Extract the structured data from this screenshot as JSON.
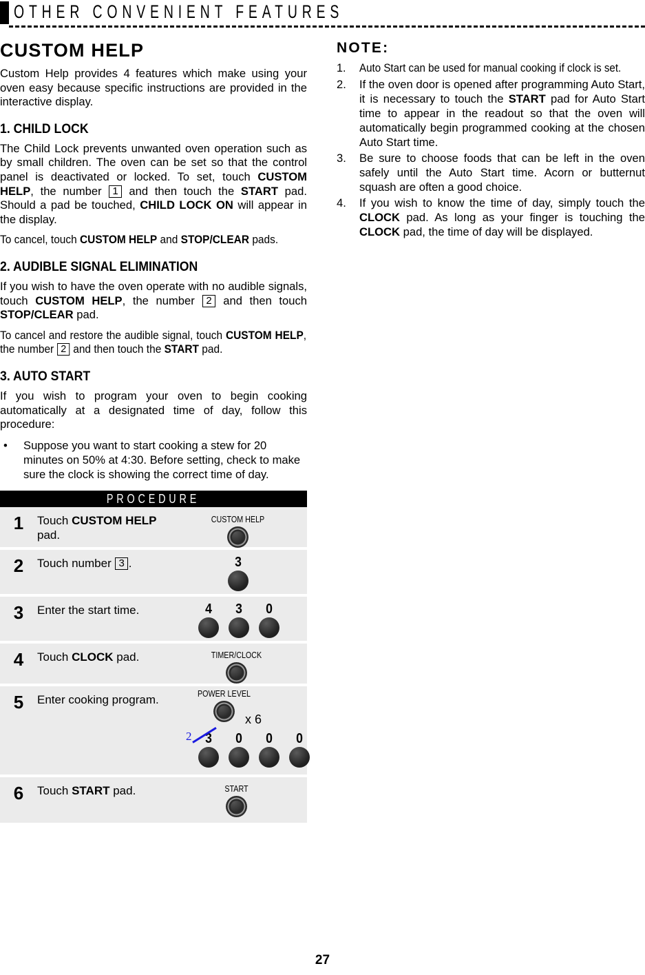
{
  "header": {
    "title": "OTHER CONVENIENT FEATURES"
  },
  "left_column": {
    "section_title": "CUSTOM HELP",
    "intro": "Custom Help provides 4 features which make using your oven easy because specific instructions are provided in the interactive display.",
    "child_lock": {
      "heading": "1.  CHILD LOCK",
      "p1_a": "The Child Lock prevents unwanted oven operation such as by small children. The oven can be set so that the control panel is deactivated or locked. To set, touch ",
      "p1_b": "CUSTOM HELP",
      "p1_c": ", the number ",
      "p1_key": "1",
      "p1_d": " and then touch the ",
      "p1_e": "START",
      "p1_f": " pad. Should a pad be touched, ",
      "p1_g": "CHILD LOCK ON",
      "p1_h": " will appear in the display.",
      "p2_a": "To cancel, touch ",
      "p2_b": "CUSTOM HELP",
      "p2_c": " and ",
      "p2_d": "STOP/CLEAR",
      "p2_e": " pads."
    },
    "audible": {
      "heading": "2.  AUDIBLE SIGNAL ELIMINATION",
      "p1_a": "If you wish to have the oven operate with no audible signals, touch ",
      "p1_b": "CUSTOM HELP",
      "p1_c": ", the number ",
      "p1_key": "2",
      "p1_d": " and then touch ",
      "p1_e": "STOP/CLEAR",
      "p1_f": " pad.",
      "p2_a": "To cancel and restore the audible signal, touch ",
      "p2_b": "CUSTOM HELP",
      "p2_c": ", the number ",
      "p2_key": "2",
      "p2_d": " and then touch the ",
      "p2_e": "START",
      "p2_f": " pad."
    },
    "auto_start": {
      "heading": "3.  AUTO START",
      "p1": "If you wish to program your oven to begin cooking automatically at a designated time of day, follow this procedure:",
      "bullet_dot": "•",
      "bullet1": "Suppose you want to start cooking a stew for 20 minutes on 50% at 4:30. Before setting, check to make sure the clock is showing the correct time of day."
    }
  },
  "procedure": {
    "heading": "PROCEDURE",
    "steps": [
      {
        "num": "1",
        "text_a": "Touch ",
        "text_b": "CUSTOM HELP",
        "text_c": " pad.",
        "pads": [
          {
            "caption": "CUSTOM HELP",
            "style": "ringed",
            "digit": ""
          }
        ]
      },
      {
        "num": "2",
        "text_a": "Touch number ",
        "key": "3",
        "text_c": ".",
        "pads": [
          {
            "caption": "",
            "style": "plain",
            "digit": "3"
          }
        ]
      },
      {
        "num": "3",
        "text_a": "Enter the start time.",
        "text_b": "",
        "text_c": "",
        "pads": [
          {
            "caption": "",
            "style": "plain",
            "digit": "4"
          },
          {
            "caption": "",
            "style": "plain",
            "digit": "3"
          },
          {
            "caption": "",
            "style": "plain",
            "digit": "0"
          }
        ]
      },
      {
        "num": "4",
        "text_a": "Touch ",
        "text_b": "CLOCK",
        "text_c": " pad.",
        "pads": [
          {
            "caption": "TIMER/CLOCK",
            "style": "ringed",
            "digit": ""
          }
        ]
      },
      {
        "num": "5",
        "text_a": "Enter cooking program.",
        "text_b": "",
        "text_c": "",
        "power_caption": "POWER LEVEL",
        "multiplier": "x 6",
        "pads": [
          {
            "caption": "",
            "style": "plain",
            "digit": "3"
          },
          {
            "caption": "",
            "style": "plain",
            "digit": "0"
          },
          {
            "caption": "",
            "style": "plain",
            "digit": "0"
          },
          {
            "caption": "",
            "style": "plain",
            "digit": "0"
          }
        ],
        "annotation": {
          "corrected_digit": "2",
          "color": "#1a1ae0"
        }
      },
      {
        "num": "6",
        "text_a": "Touch ",
        "text_b": "START",
        "text_c": " pad.",
        "pads": [
          {
            "caption": "START",
            "style": "ringed",
            "digit": ""
          }
        ]
      }
    ]
  },
  "right_column": {
    "note_title": "NOTE:",
    "notes": [
      {
        "num": "1.",
        "a": "Auto Start can be used for manual cooking if clock is set.",
        "b": "",
        "c": "",
        "d": "",
        "e": "",
        "f": ""
      },
      {
        "num": "2.",
        "a": "If the oven door is opened after programming Auto Start, it is necessary to touch the ",
        "b": "START",
        "c": " pad for Auto Start time to appear in the readout so that the oven will automatically begin programmed  cooking at the chosen Auto Start time.",
        "d": "",
        "e": "",
        "f": ""
      },
      {
        "num": "3.",
        "a": "Be sure to choose foods that can be left in the oven safely until the Auto Start time. Acorn or butternut squash are often a good choice.",
        "b": "",
        "c": "",
        "d": "",
        "e": "",
        "f": ""
      },
      {
        "num": "4.",
        "a": "If you wish to know the time of day, simply touch the ",
        "b": "CLOCK",
        "c": " pad. As long as your finger is touching the ",
        "d": "CLOCK",
        "e": " pad, the time of day will be displayed.",
        "f": ""
      }
    ]
  },
  "footer": {
    "page_number": "27"
  }
}
